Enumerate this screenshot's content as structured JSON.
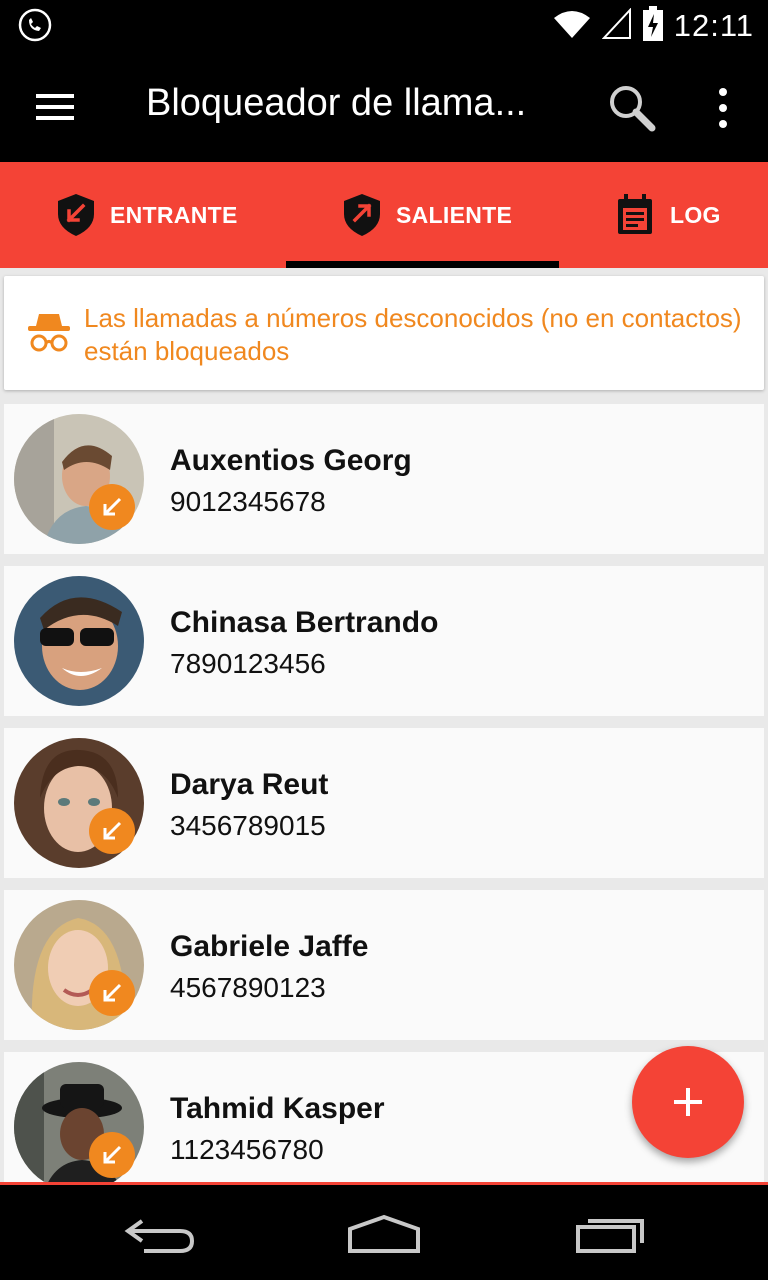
{
  "status_bar": {
    "time": "12:11"
  },
  "app_bar": {
    "title": "Bloqueador de llama..."
  },
  "tabs": [
    {
      "label": "ENTRANTE",
      "icon": "incoming-shield-icon",
      "selected": false
    },
    {
      "label": "SALIENTE",
      "icon": "outgoing-shield-icon",
      "selected": true
    },
    {
      "label": "LOG",
      "icon": "log-icon",
      "selected": false
    }
  ],
  "banner": {
    "text": "Las llamadas a números desconocidos (no en contactos) están bloqueados",
    "icon": "incognito-icon",
    "color": "#f0881f"
  },
  "contacts": [
    {
      "name": "Auxentios Georg",
      "phone": "9012345678",
      "badge": true
    },
    {
      "name": "Chinasa Bertrando",
      "phone": "7890123456",
      "badge": false
    },
    {
      "name": "Darya Reut",
      "phone": "3456789015",
      "badge": true
    },
    {
      "name": "Gabriele Jaffe",
      "phone": "4567890123",
      "badge": true
    },
    {
      "name": "Tahmid Kasper",
      "phone": "1123456780",
      "badge": true
    }
  ],
  "colors": {
    "accent": "#f44336",
    "badge": "#f0881f",
    "app_bar": "#000000"
  }
}
